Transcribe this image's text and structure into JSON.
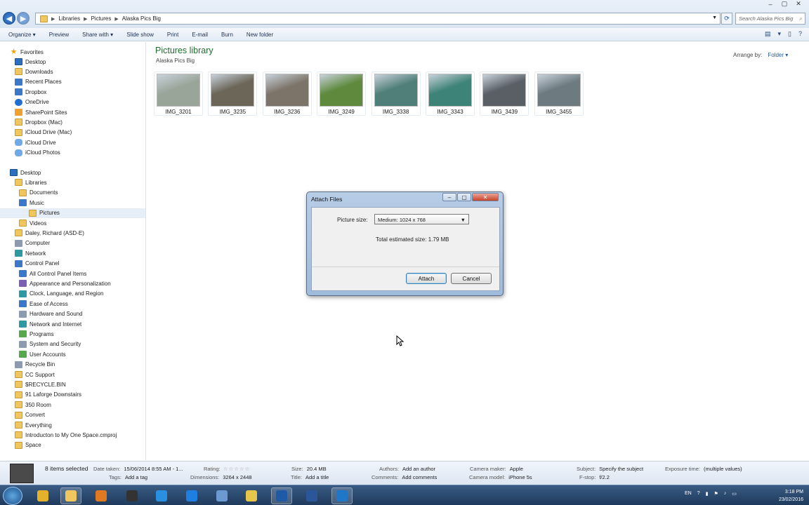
{
  "window": {
    "title_buttons": [
      "–",
      "▢",
      "✕"
    ]
  },
  "address": {
    "crumbs": [
      "Libraries",
      "Pictures",
      "Alaska Pics Big"
    ],
    "search_placeholder": "Search Alaska Pics Big"
  },
  "toolbar": {
    "items": [
      "Organize ▾",
      "Preview",
      "Share with ▾",
      "Slide show",
      "Print",
      "E-mail",
      "Burn",
      "New folder"
    ]
  },
  "sidebar": {
    "favorites_label": "Favorites",
    "items": [
      {
        "label": "Desktop",
        "icon": "desktop-icon"
      },
      {
        "label": "Downloads",
        "icon": "downloads-icon"
      },
      {
        "label": "Recent Places",
        "icon": "recent-places-icon"
      },
      {
        "label": "Dropbox",
        "icon": "dropbox-icon"
      },
      {
        "label": "OneDrive",
        "icon": "onedrive-icon"
      },
      {
        "label": "SharePoint Sites",
        "icon": "sharepoint-icon"
      },
      {
        "label": "Dropbox (Mac)",
        "icon": "folder-icon"
      },
      {
        "label": "iCloud Drive (Mac)",
        "icon": "folder-icon"
      },
      {
        "label": "iCloud Drive",
        "icon": "icloud-icon"
      },
      {
        "label": "iCloud Photos",
        "icon": "icloud-photos-icon"
      }
    ],
    "tree": [
      {
        "label": "Desktop",
        "icon": "desktop-icon"
      },
      {
        "label": "Libraries",
        "icon": "libraries-icon"
      },
      {
        "label": "Documents",
        "icon": "documents-icon"
      },
      {
        "label": "Music",
        "icon": "music-icon"
      },
      {
        "label": "Pictures",
        "icon": "pictures-icon",
        "selected": true
      },
      {
        "label": "Videos",
        "icon": "videos-icon"
      },
      {
        "label": "Daley, Richard (ASD-E)",
        "icon": "user-icon"
      },
      {
        "label": "Computer",
        "icon": "computer-icon"
      },
      {
        "label": "Network",
        "icon": "network-icon"
      },
      {
        "label": "Control Panel",
        "icon": "control-panel-icon"
      },
      {
        "label": "All Control Panel Items",
        "icon": "control-panel-icon"
      },
      {
        "label": "Appearance and Personalization",
        "icon": "appearance-icon"
      },
      {
        "label": "Clock, Language, and Region",
        "icon": "clock-icon"
      },
      {
        "label": "Ease of Access",
        "icon": "ease-of-access-icon"
      },
      {
        "label": "Hardware and Sound",
        "icon": "hardware-icon"
      },
      {
        "label": "Network and Internet",
        "icon": "network-icon"
      },
      {
        "label": "Programs",
        "icon": "programs-icon"
      },
      {
        "label": "System and Security",
        "icon": "security-icon"
      },
      {
        "label": "User Accounts",
        "icon": "user-accounts-icon"
      },
      {
        "label": "Recycle Bin",
        "icon": "recycle-bin-icon"
      },
      {
        "label": "CC Support",
        "icon": "folder-icon"
      },
      {
        "label": "$RECYCLE.BIN",
        "icon": "folder-icon"
      },
      {
        "label": "91 Laforge Downstairs",
        "icon": "folder-icon"
      },
      {
        "label": "350 Room",
        "icon": "folder-icon"
      },
      {
        "label": "Convert",
        "icon": "folder-icon"
      },
      {
        "label": "Everything",
        "icon": "folder-icon"
      },
      {
        "label": "Introducton to My One Space.cmproj",
        "icon": "folder-icon"
      },
      {
        "label": "Space",
        "icon": "folder-icon"
      }
    ]
  },
  "content": {
    "title": "Pictures library",
    "subtitle": "Alaska Pics Big",
    "arrange_label": "Arrange by:",
    "arrange_value": "Folder ▾",
    "thumbnails": [
      {
        "name": "IMG_3201",
        "color": "#9aa59a"
      },
      {
        "name": "IMG_3235",
        "color": "#6b6658"
      },
      {
        "name": "IMG_3236",
        "color": "#7c7468"
      },
      {
        "name": "IMG_3249",
        "color": "#5f8a3e"
      },
      {
        "name": "IMG_3338",
        "color": "#4f7f78"
      },
      {
        "name": "IMG_3343",
        "color": "#3e8378"
      },
      {
        "name": "IMG_3439",
        "color": "#5a5f66"
      },
      {
        "name": "IMG_3455",
        "color": "#6d7a80"
      }
    ]
  },
  "dialog": {
    "title": "Attach Files",
    "picture_size_label": "Picture size:",
    "picture_size_value": "Medium: 1024 x 768",
    "estimated": "Total estimated size: 1.79 MB",
    "attach_label": "Attach",
    "cancel_label": "Cancel"
  },
  "details": {
    "count": "8 items selected",
    "date_taken_label": "Date taken:",
    "date_taken": "15/06/2014 8:55 AM - 1...",
    "tags_label": "Tags:",
    "tags": "Add a tag",
    "rating_label": "Rating:",
    "rating_stars": "☆☆☆☆☆",
    "dimensions_label": "Dimensions:",
    "dimensions": "3264 x 2448",
    "size_label": "Size:",
    "size": "20.4 MB",
    "title_label": "Title:",
    "title": "Add a title",
    "authors_label": "Authors:",
    "authors": "Add an author",
    "comments_label": "Comments:",
    "comments": "Add comments",
    "camera_maker_label": "Camera maker:",
    "camera_maker": "Apple",
    "camera_model_label": "Camera model:",
    "camera_model": "iPhone 5s",
    "subject_label": "Subject:",
    "subject": "Specify the subject",
    "fstop_label": "F-stop:",
    "fstop": "f/2.2",
    "exposure_label": "Exposure time:",
    "exposure": "(multiple values)"
  },
  "taskbar": {
    "apps": [
      {
        "name": "chrome-icon",
        "color": "#e4b22a"
      },
      {
        "name": "explorer-icon",
        "color": "#f0c75e",
        "active": true
      },
      {
        "name": "media-player-icon",
        "color": "#e07a22"
      },
      {
        "name": "camera-icon",
        "color": "#333333"
      },
      {
        "name": "ie-icon",
        "color": "#2a8fe0"
      },
      {
        "name": "dropbox-icon",
        "color": "#1f7fe0"
      },
      {
        "name": "safari-icon",
        "color": "#6c9ad0"
      },
      {
        "name": "apps-grid-icon",
        "color": "#e6c64a"
      },
      {
        "name": "outlook-icon",
        "color": "#1e5aa6",
        "active": true
      },
      {
        "name": "word-icon",
        "color": "#2b579a"
      },
      {
        "name": "lync-icon",
        "color": "#1f77c8",
        "active": true
      }
    ],
    "lang": "EN",
    "time": "3:18 PM",
    "date": "23/02/2016"
  }
}
